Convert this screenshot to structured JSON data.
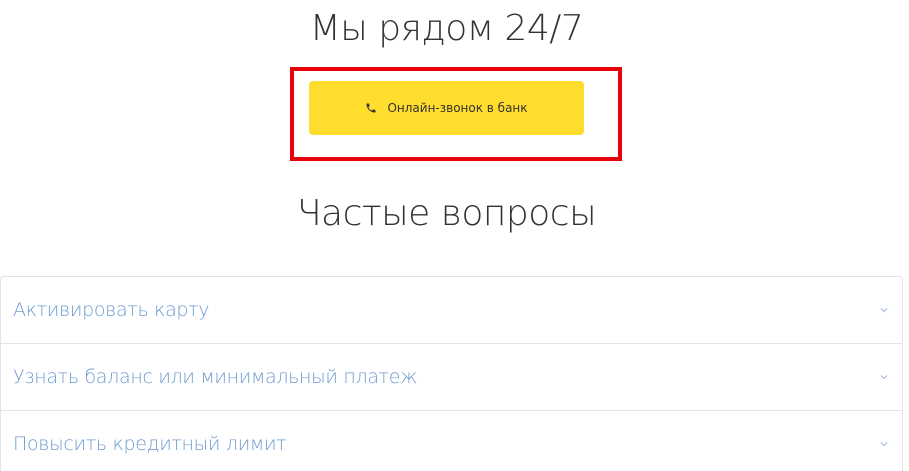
{
  "support": {
    "title": "Мы рядом 24/7",
    "call_button_label": "Онлайн-звонок в банк",
    "call_icon": "phone-icon",
    "highlight_color": "#e8000b"
  },
  "faq": {
    "title": "Частые вопросы",
    "items": [
      {
        "label": "Активировать карту"
      },
      {
        "label": "Узнать баланс или минимальный платеж"
      },
      {
        "label": "Повысить кредитный лимит"
      }
    ]
  },
  "colors": {
    "button_bg": "#ffdd2d",
    "faq_text": "#6e9bd0",
    "heading_text": "#333333"
  }
}
